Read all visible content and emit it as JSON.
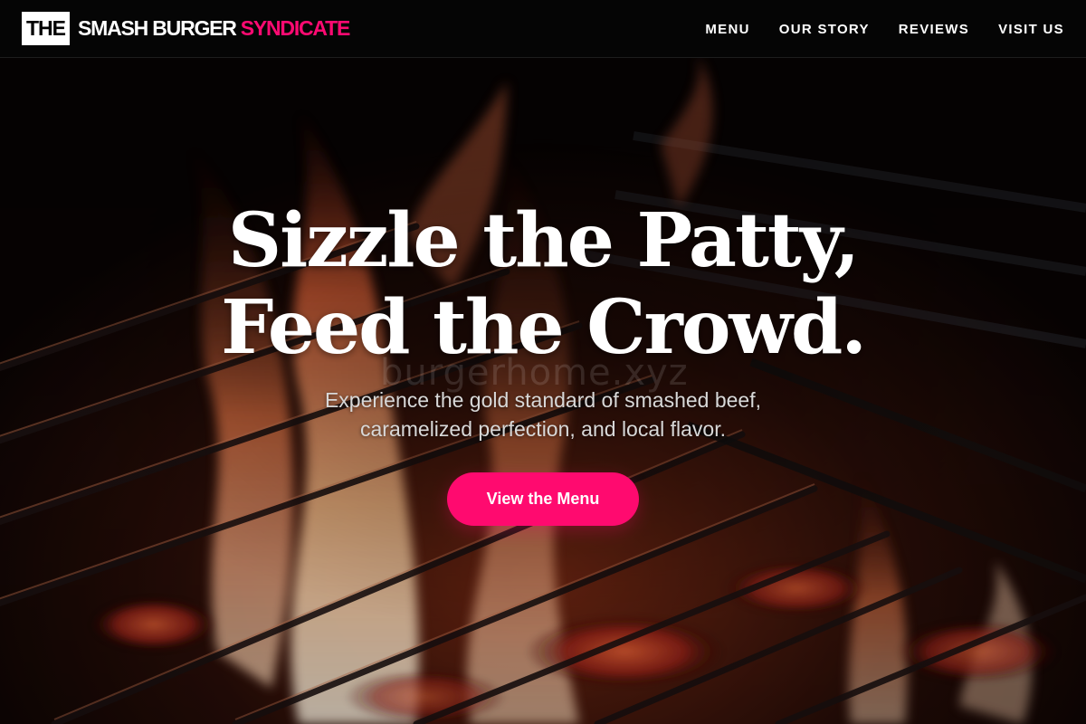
{
  "header": {
    "logo_box": "THE",
    "logo_main": "SMASH BURGER",
    "logo_accent": "SYNDICATE",
    "nav": [
      {
        "label": "MENU"
      },
      {
        "label": "OUR STORY"
      },
      {
        "label": "REVIEWS"
      },
      {
        "label": "VISIT US"
      }
    ]
  },
  "hero": {
    "headline_line1": "Sizzle the Patty,",
    "headline_line2": "Feed the Crowd.",
    "watermark": "burgerhome.xyz",
    "subhead_line1": "Experience the gold standard of smashed beef,",
    "subhead_line2": "caramelized perfection, and local flavor.",
    "cta_label": "View the Menu",
    "background_image": "fire-grill-image"
  },
  "colors": {
    "accent": "#ff0a72",
    "header_bg": "#050505",
    "text": "#ffffff"
  }
}
